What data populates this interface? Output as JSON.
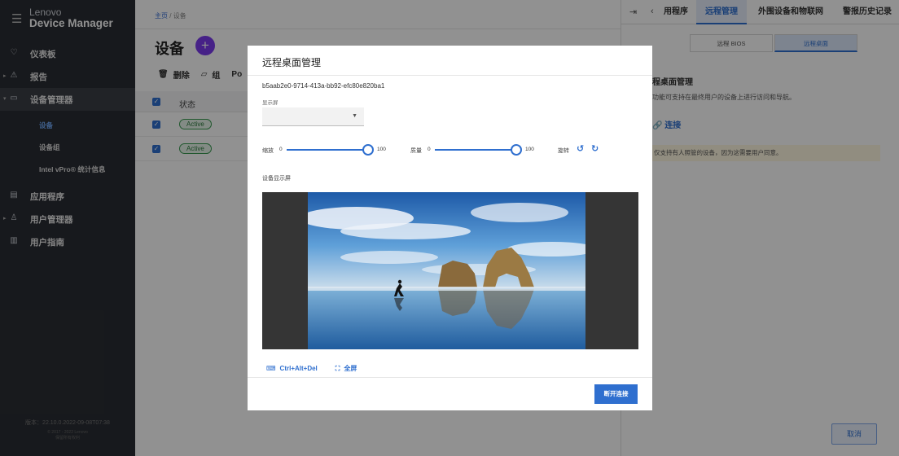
{
  "app": {
    "brand_line1": "Lenovo",
    "brand_line2": "Device Manager"
  },
  "sidebar": {
    "items": [
      {
        "label": "仪表板",
        "icon": "dashboard-icon"
      },
      {
        "label": "报告",
        "icon": "warning-icon"
      },
      {
        "label": "设备管理器",
        "icon": "monitor-icon"
      },
      {
        "label": "应用程序",
        "icon": "app-window-icon"
      },
      {
        "label": "用户管理器",
        "icon": "user-icon"
      },
      {
        "label": "用户指南",
        "icon": "book-icon"
      }
    ],
    "subitems": [
      {
        "label": "设备"
      },
      {
        "label": "设备组"
      },
      {
        "label": "Intel vPro® 统计信息"
      }
    ],
    "version": "版本：22.10.0.2022-09-08T07:38",
    "copyright_line1": "© 2017 - 2022 Lenovo",
    "copyright_line2": "保留所有权利"
  },
  "main": {
    "breadcrumb_home": "主页",
    "breadcrumb_current": "设备",
    "page_title": "设备",
    "toolbar": {
      "delete": "删除",
      "group": "组",
      "power": "Po"
    },
    "table": {
      "status_header": "状态",
      "rows": [
        {
          "status": "Active"
        },
        {
          "status": "Active"
        }
      ]
    }
  },
  "right_panel": {
    "tabs": [
      {
        "label": "用程序"
      },
      {
        "label": "远程管理"
      },
      {
        "label": "外围设备和物联网"
      },
      {
        "label": "警报历史记录"
      }
    ],
    "segments": [
      {
        "label": "远程 BIOS"
      },
      {
        "label": "远程桌面"
      }
    ],
    "section_title": "程桌面管理",
    "description": "功能可支持在最终用户的设备上进行访问和导航。",
    "connect_link": "连接",
    "warning": "仅支持有人照管的设备，因为这需要用户同意。",
    "cancel": "取消"
  },
  "modal": {
    "title": "远程桌面管理",
    "device_id": "b5aab2e0-9714-413a-bb92-efc80e820ba1",
    "display_label": "显示屏",
    "display_value": "",
    "zoom_label": "缩放",
    "zoom_min": "0",
    "zoom_max": "100",
    "zoom_value": 1.0,
    "quality_label": "质量",
    "quality_min": "0",
    "quality_max": "100",
    "quality_value": 1.0,
    "rotate_label": "旋转",
    "device_screen_label": "设备显示屏",
    "ctrl_alt_del": "Ctrl+Alt+Del",
    "fullscreen": "全屏",
    "disconnect": "断开连接"
  },
  "colors": {
    "accent": "#2f6fcf",
    "sidebar_bg": "#2a2d33",
    "add_button": "#7c3aed",
    "status_green": "#3a9b51"
  }
}
